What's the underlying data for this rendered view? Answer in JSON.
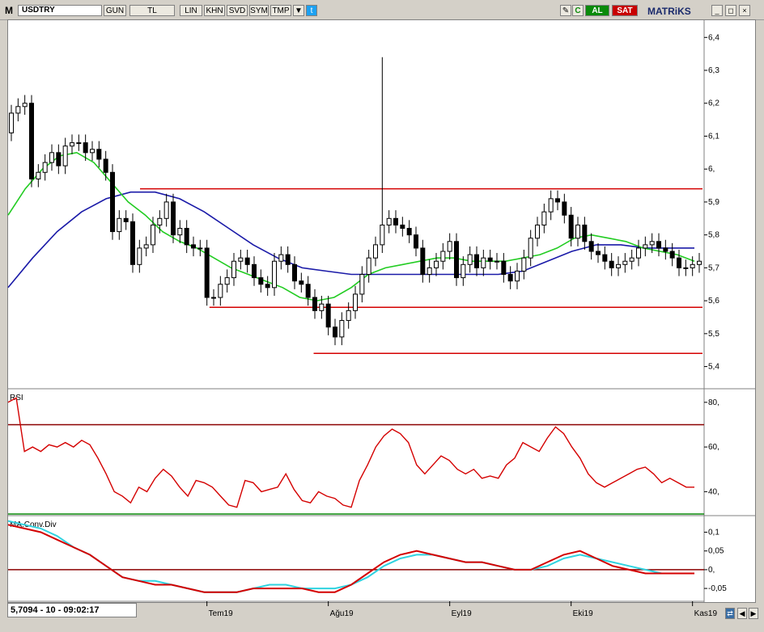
{
  "toolbar": {
    "logo": "M",
    "symbol": "USDTRY",
    "buttons": [
      "GUN",
      "TL",
      "LIN",
      "KHN",
      "SVD",
      "SYM",
      "TMP"
    ],
    "al_label": "AL",
    "sat_label": "SAT",
    "brand": "MATRiKS",
    "colors": {
      "al": "#0a8a0a",
      "sat": "#c80000"
    }
  },
  "status_text": "5,7094 - 10 - 09:02:17",
  "indicators": {
    "rsi_label": "RSI",
    "macd_label": "MA.Conv.Div"
  },
  "chart_data": {
    "type": "candlestick",
    "symbol": "USDTRY",
    "price_axis": {
      "ticks": [
        "6,4",
        "6,3",
        "6,2",
        "6,1",
        "6,",
        "5,9",
        "5,8",
        "5,7",
        "5,6",
        "5,5",
        "5,4"
      ],
      "tick_values": [
        6.4,
        6.3,
        6.2,
        6.1,
        6.0,
        5.9,
        5.8,
        5.7,
        5.6,
        5.5,
        5.4
      ],
      "ylim": [
        5.34,
        6.44
      ]
    },
    "time_axis": {
      "labels": [
        "Tem19",
        "Ağu19",
        "Eyl19",
        "Eki19",
        "Kas19"
      ],
      "label_indices": [
        29,
        47,
        65,
        83,
        101
      ]
    },
    "closes": [
      6.17,
      6.19,
      6.2,
      5.97,
      5.99,
      6.02,
      6.05,
      6.01,
      6.07,
      6.08,
      6.08,
      6.05,
      6.06,
      6.03,
      5.99,
      5.81,
      5.85,
      5.84,
      5.71,
      5.76,
      5.77,
      5.83,
      5.85,
      5.9,
      5.8,
      5.82,
      5.77,
      5.76,
      5.76,
      5.61,
      5.61,
      5.65,
      5.67,
      5.72,
      5.73,
      5.71,
      5.67,
      5.65,
      5.64,
      5.72,
      5.74,
      5.71,
      5.66,
      5.65,
      5.61,
      5.57,
      5.59,
      5.52,
      5.49,
      5.54,
      5.57,
      5.62,
      5.68,
      5.73,
      5.77,
      5.83,
      5.85,
      5.83,
      5.82,
      5.8,
      5.76,
      5.68,
      5.7,
      5.72,
      5.75,
      5.78,
      5.67,
      5.71,
      5.74,
      5.7,
      5.73,
      5.72,
      5.72,
      5.68,
      5.66,
      5.69,
      5.73,
      5.79,
      5.83,
      5.87,
      5.91,
      5.9,
      5.86,
      5.79,
      5.83,
      5.78,
      5.75,
      5.74,
      5.72,
      5.7,
      5.71,
      5.72,
      5.73,
      5.76,
      5.77,
      5.78,
      5.76,
      5.75,
      5.73,
      5.7,
      5.7,
      5.71,
      5.72
    ],
    "opens": [
      6.11,
      6.17,
      6.19,
      6.2,
      5.97,
      5.99,
      6.02,
      6.05,
      6.01,
      6.07,
      6.08,
      6.08,
      6.05,
      6.06,
      6.03,
      5.99,
      5.81,
      5.85,
      5.84,
      5.71,
      5.76,
      5.77,
      5.83,
      5.85,
      5.9,
      5.8,
      5.82,
      5.77,
      5.76,
      5.76,
      5.61,
      5.61,
      5.65,
      5.67,
      5.72,
      5.73,
      5.71,
      5.67,
      5.65,
      5.64,
      5.72,
      5.74,
      5.71,
      5.66,
      5.65,
      5.61,
      5.57,
      5.59,
      5.52,
      5.49,
      5.54,
      5.57,
      5.62,
      5.68,
      5.73,
      5.77,
      5.83,
      5.85,
      5.83,
      5.82,
      5.8,
      5.76,
      5.68,
      5.7,
      5.72,
      5.75,
      5.78,
      5.67,
      5.71,
      5.74,
      5.7,
      5.73,
      5.72,
      5.72,
      5.68,
      5.66,
      5.69,
      5.73,
      5.79,
      5.83,
      5.87,
      5.91,
      5.9,
      5.86,
      5.79,
      5.83,
      5.78,
      5.75,
      5.74,
      5.72,
      5.7,
      5.71,
      5.72,
      5.73,
      5.76,
      5.77,
      5.78,
      5.76,
      5.75,
      5.73,
      5.7,
      5.7,
      5.71
    ],
    "spike": {
      "index": 55,
      "high": 6.34
    },
    "ma_fast": [
      5.86,
      5.94,
      6.0,
      6.04,
      6.05,
      6.02,
      5.96,
      5.9,
      5.86,
      5.81,
      5.78,
      5.76,
      5.73,
      5.7,
      5.68,
      5.66,
      5.64,
      5.61,
      5.6,
      5.61,
      5.64,
      5.68,
      5.7,
      5.71,
      5.72,
      5.73,
      5.73,
      5.72,
      5.72,
      5.72,
      5.73,
      5.74,
      5.76,
      5.79,
      5.8,
      5.79,
      5.78,
      5.76,
      5.75,
      5.74,
      5.72
    ],
    "ma_slow": [
      5.64,
      5.73,
      5.81,
      5.87,
      5.91,
      5.93,
      5.93,
      5.91,
      5.87,
      5.82,
      5.77,
      5.73,
      5.7,
      5.69,
      5.68,
      5.68,
      5.68,
      5.68,
      5.68,
      5.68,
      5.68,
      5.69,
      5.72,
      5.75,
      5.77,
      5.77,
      5.76,
      5.76,
      5.76
    ],
    "h_lines": [
      {
        "value": 5.94,
        "color": "#d40000"
      },
      {
        "value": 5.58,
        "color": "#d40000"
      },
      {
        "value": 5.44,
        "color": "#d40000"
      }
    ],
    "rsi": {
      "ticks": [
        "80,",
        "60,",
        "40,"
      ],
      "tick_values": [
        80,
        60,
        40
      ],
      "ylim": [
        30,
        85
      ],
      "levels": [
        70,
        30
      ],
      "values": [
        80,
        82,
        58,
        60,
        58,
        61,
        60,
        62,
        60,
        63,
        61,
        55,
        48,
        40,
        38,
        35,
        42,
        40,
        46,
        50,
        47,
        42,
        38,
        45,
        44,
        42,
        38,
        34,
        33,
        45,
        44,
        40,
        41,
        42,
        48,
        41,
        36,
        35,
        40,
        38,
        37,
        34,
        33,
        45,
        52,
        60,
        65,
        68,
        66,
        62,
        52,
        48,
        52,
        56,
        54,
        50,
        48,
        50,
        46,
        47,
        46,
        52,
        55,
        62,
        60,
        58,
        64,
        69,
        66,
        60,
        55,
        48,
        44,
        42,
        44,
        46,
        48,
        50,
        51,
        48,
        44,
        46,
        44,
        42,
        42
      ]
    },
    "macd": {
      "ticks": [
        "0,1",
        "0,05",
        "0,",
        "-0,05"
      ],
      "tick_values": [
        0.1,
        0.05,
        0,
        -0.05
      ],
      "ylim": [
        -0.08,
        0.14
      ],
      "zero_line": 0,
      "macd_line": [
        0.12,
        0.11,
        0.1,
        0.08,
        0.06,
        0.04,
        0.01,
        -0.02,
        -0.03,
        -0.04,
        -0.04,
        -0.05,
        -0.06,
        -0.06,
        -0.06,
        -0.05,
        -0.05,
        -0.05,
        -0.05,
        -0.06,
        -0.06,
        -0.04,
        -0.01,
        0.02,
        0.04,
        0.05,
        0.04,
        0.03,
        0.02,
        0.02,
        0.01,
        0.0,
        0.0,
        0.02,
        0.04,
        0.05,
        0.03,
        0.01,
        0.0,
        -0.01,
        -0.01,
        -0.01,
        -0.01
      ],
      "signal_line": [
        0.13,
        0.12,
        0.11,
        0.09,
        0.06,
        0.04,
        0.01,
        -0.02,
        -0.03,
        -0.03,
        -0.04,
        -0.05,
        -0.06,
        -0.06,
        -0.06,
        -0.05,
        -0.04,
        -0.04,
        -0.05,
        -0.05,
        -0.05,
        -0.04,
        -0.02,
        0.01,
        0.03,
        0.04,
        0.04,
        0.03,
        0.02,
        0.02,
        0.01,
        0.0,
        0.0,
        0.01,
        0.03,
        0.04,
        0.03,
        0.02,
        0.01,
        0.0,
        -0.01,
        -0.01,
        -0.01
      ],
      "colors": {
        "macd_line": "#d40000",
        "signal_line": "#2fd3e0"
      }
    },
    "colors": {
      "candle": "#000000",
      "ma_fast": "#22cc22",
      "ma_slow": "#1a1aa8",
      "rsi": "#d40000",
      "rsi_upper": "#8b0000",
      "rsi_lower": "#0a8a0a"
    }
  }
}
